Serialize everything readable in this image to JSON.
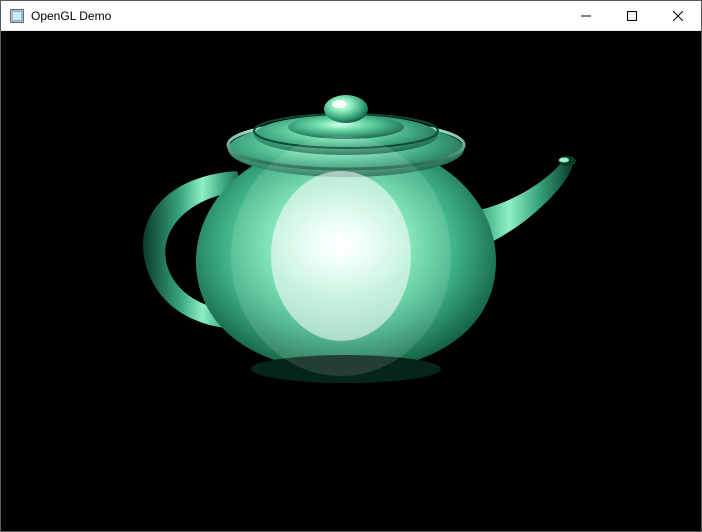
{
  "window": {
    "title": "OpenGL Demo",
    "controls": {
      "minimize_tip": "Minimize",
      "maximize_tip": "Maximize",
      "close_tip": "Close"
    }
  },
  "scene": {
    "object": "utah-teapot",
    "material": "shiny-green-phong",
    "base_color": "#58d09a",
    "highlight_color": "#ffffff",
    "shadow_color": "#0a2a1e",
    "background_color": "#000000"
  }
}
